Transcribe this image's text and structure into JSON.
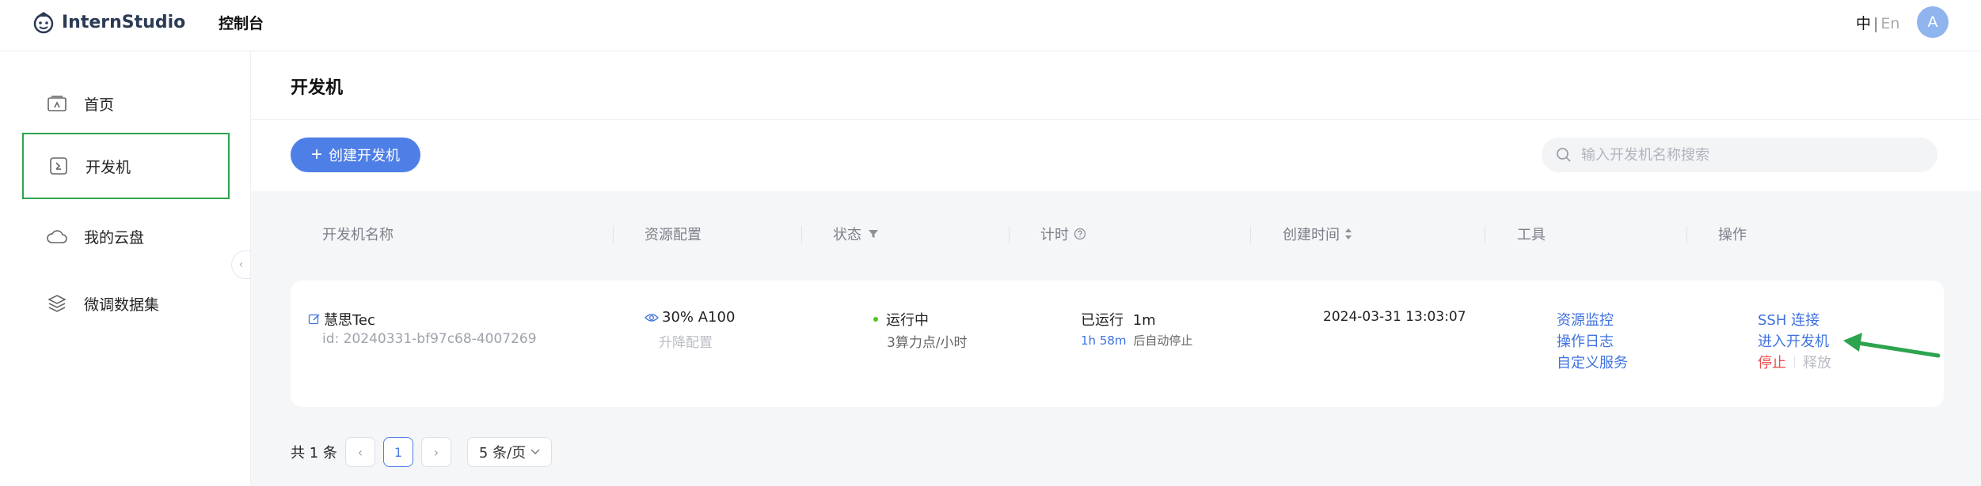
{
  "header": {
    "brand": "InternStudio",
    "console": "控制台",
    "lang_zh": "中",
    "lang_sep": "|",
    "lang_en": "En",
    "avatar_letter": "A"
  },
  "sidebar": {
    "items": [
      {
        "label": "首页",
        "icon": "home-icon"
      },
      {
        "label": "开发机",
        "icon": "terminal-icon"
      },
      {
        "label": "我的云盘",
        "icon": "cloud-icon"
      },
      {
        "label": "微调数据集",
        "icon": "dataset-icon"
      }
    ]
  },
  "page": {
    "title": "开发机",
    "create_button": "创建开发机",
    "search_placeholder": "输入开发机名称搜索"
  },
  "table": {
    "headers": {
      "name": "开发机名称",
      "resource": "资源配置",
      "status": "状态",
      "timer": "计时",
      "created": "创建时间",
      "tools": "工具",
      "actions": "操作"
    },
    "row": {
      "name": "慧思Tec",
      "id": "id: 20240331-bf97c68-4007269",
      "resource": "30% A100",
      "upgrade": "升降配置",
      "status": "运行中",
      "rate": "3算力点/小时",
      "timer_label": "已运行",
      "timer_value": "1m",
      "auto_stop_time": "1h 58m",
      "auto_stop_text": "后自动停止",
      "created": "2024-03-31 13:03:07",
      "tools": [
        "资源监控",
        "操作日志",
        "自定义服务"
      ],
      "action_ssh": "SSH 连接",
      "action_enter": "进入开发机",
      "action_stop": "停止",
      "action_release": "释放"
    }
  },
  "pagination": {
    "total": "共 1 条",
    "current": "1",
    "page_size": "5 条/页"
  },
  "colors": {
    "primary": "#4e7fe6",
    "link": "#3f72e0",
    "running_dot": "#52c41a",
    "stop": "#ef4f4f",
    "annotation_green": "#2da44e"
  }
}
